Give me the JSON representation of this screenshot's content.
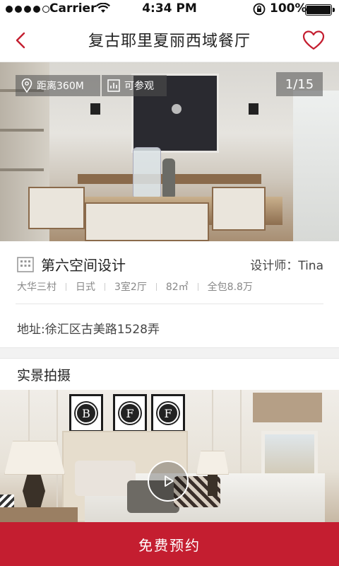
{
  "status_bar": {
    "carrier": "Carrier",
    "time": "4:34 PM",
    "battery": "100%",
    "icons": [
      "signal-icon",
      "wifi-icon",
      "rotation-lock-icon",
      "battery-icon"
    ]
  },
  "nav": {
    "title": "复古耶里夏丽西域餐厅",
    "back_icon": "back-chevron-icon",
    "favorite_icon": "heart-outline-icon",
    "accent_color": "#c41e30"
  },
  "hero": {
    "distance_label": "距离360M",
    "visit_label": "可参观",
    "counter": "1/15",
    "icons": [
      "location-pin-icon",
      "chart-icon"
    ]
  },
  "company": {
    "name": "第六空间设计",
    "designer": "设计师：Tina",
    "specs": [
      "大华三村",
      "日式",
      "3室2厅",
      "82㎡",
      "全包8.8万"
    ],
    "address": "地址:徐汇区古美路1528弄",
    "icon": "building-icon"
  },
  "section": {
    "title": "实景拍摄",
    "photo_letters": [
      "B",
      "F",
      "F"
    ],
    "play_icon": "play-icon"
  },
  "cta": {
    "label": "免费预约",
    "color": "#c41e30"
  }
}
